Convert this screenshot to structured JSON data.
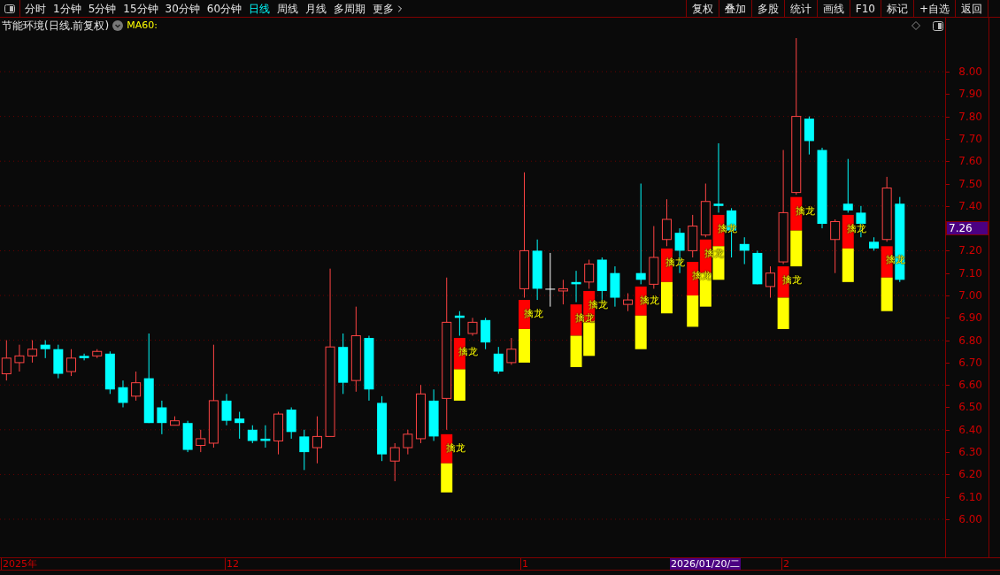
{
  "toolbar": {
    "periods": [
      {
        "label": "分时",
        "selected": false
      },
      {
        "label": "1分钟",
        "selected": false
      },
      {
        "label": "5分钟",
        "selected": false
      },
      {
        "label": "15分钟",
        "selected": false
      },
      {
        "label": "30分钟",
        "selected": false
      },
      {
        "label": "60分钟",
        "selected": false
      },
      {
        "label": "日线",
        "selected": true
      },
      {
        "label": "周线",
        "selected": false
      },
      {
        "label": "月线",
        "selected": false
      },
      {
        "label": "多周期",
        "selected": false
      },
      {
        "label": "更多",
        "selected": false
      }
    ],
    "actions": [
      "复权",
      "叠加",
      "多股",
      "统计",
      "画线",
      "F10",
      "标记",
      "+自选",
      "返回"
    ]
  },
  "chart": {
    "title": "节能环境(日线.前复权)",
    "indicator": "MA60:",
    "current_price": "7.26",
    "chart_data": {
      "type": "candlestick",
      "grid": true,
      "ylim": [
        5.83,
        8.17
      ],
      "yticks": [
        {
          "value": 8.0,
          "label": "8.00"
        },
        {
          "value": 7.9,
          "label": "7.90"
        },
        {
          "value": 7.8,
          "label": "7.80"
        },
        {
          "value": 7.7,
          "label": "7.70"
        },
        {
          "value": 7.6,
          "label": "7.60"
        },
        {
          "value": 7.5,
          "label": "7.50"
        },
        {
          "value": 7.4,
          "label": "7.40"
        },
        {
          "value": 7.2,
          "label": "7.20"
        },
        {
          "value": 7.1,
          "label": "7.10"
        },
        {
          "value": 7.0,
          "label": "7.00"
        },
        {
          "value": 6.9,
          "label": "6.90"
        },
        {
          "value": 6.8,
          "label": "6.80"
        },
        {
          "value": 6.7,
          "label": "6.70"
        },
        {
          "value": 6.6,
          "label": "6.60"
        },
        {
          "value": 6.5,
          "label": "6.50"
        },
        {
          "value": 6.4,
          "label": "6.40"
        },
        {
          "value": 6.3,
          "label": "6.30"
        },
        {
          "value": 6.2,
          "label": "6.20"
        },
        {
          "value": 6.1,
          "label": "6.10"
        },
        {
          "value": 6.0,
          "label": "6.00"
        }
      ],
      "ohlc": [
        [
          6.65,
          6.8,
          6.62,
          6.72
        ],
        [
          6.7,
          6.78,
          6.66,
          6.73
        ],
        [
          6.73,
          6.8,
          6.7,
          6.76
        ],
        [
          6.78,
          6.8,
          6.72,
          6.76
        ],
        [
          6.76,
          6.78,
          6.63,
          6.65
        ],
        [
          6.66,
          6.76,
          6.64,
          6.72
        ],
        [
          6.73,
          6.74,
          6.71,
          6.72
        ],
        [
          6.73,
          6.76,
          6.72,
          6.75
        ],
        [
          6.74,
          6.75,
          6.56,
          6.58
        ],
        [
          6.59,
          6.62,
          6.5,
          6.52
        ],
        [
          6.55,
          6.66,
          6.53,
          6.61
        ],
        [
          6.63,
          6.83,
          6.43,
          6.43
        ],
        [
          6.5,
          6.53,
          6.38,
          6.43
        ],
        [
          6.42,
          6.46,
          6.42,
          6.44
        ],
        [
          6.43,
          6.44,
          6.3,
          6.31
        ],
        [
          6.33,
          6.4,
          6.3,
          6.36
        ],
        [
          6.34,
          6.78,
          6.32,
          6.53
        ],
        [
          6.53,
          6.56,
          6.42,
          6.44
        ],
        [
          6.45,
          6.48,
          6.36,
          6.43
        ],
        [
          6.4,
          6.42,
          6.34,
          6.35
        ],
        [
          6.36,
          6.42,
          6.32,
          6.35
        ],
        [
          6.35,
          6.48,
          6.29,
          6.47
        ],
        [
          6.49,
          6.5,
          6.36,
          6.39
        ],
        [
          6.37,
          6.4,
          6.22,
          6.3
        ],
        [
          6.32,
          6.46,
          6.25,
          6.37
        ],
        [
          6.37,
          7.12,
          6.37,
          6.77
        ],
        [
          6.77,
          6.83,
          6.56,
          6.61
        ],
        [
          6.62,
          6.95,
          6.57,
          6.82
        ],
        [
          6.81,
          6.82,
          6.53,
          6.58
        ],
        [
          6.52,
          6.55,
          6.26,
          6.29
        ],
        [
          6.26,
          6.34,
          6.17,
          6.32
        ],
        [
          6.32,
          6.4,
          6.29,
          6.38
        ],
        [
          6.36,
          6.6,
          6.34,
          6.56
        ],
        [
          6.53,
          6.58,
          6.35,
          6.37
        ],
        [
          6.54,
          7.08,
          6.4,
          6.88
        ],
        [
          6.91,
          6.93,
          6.82,
          6.9
        ],
        [
          6.83,
          6.9,
          6.82,
          6.88
        ],
        [
          6.89,
          6.9,
          6.76,
          6.79
        ],
        [
          6.74,
          6.77,
          6.65,
          6.66
        ],
        [
          6.7,
          6.81,
          6.69,
          6.76
        ],
        [
          7.03,
          7.55,
          6.99,
          7.2
        ],
        [
          7.2,
          7.25,
          6.98,
          7.03
        ],
        [
          7.03,
          7.19,
          6.95,
          7.03
        ],
        [
          7.02,
          7.07,
          6.96,
          7.03
        ],
        [
          7.06,
          7.11,
          6.97,
          7.05
        ],
        [
          7.06,
          7.16,
          7.03,
          7.14
        ],
        [
          7.16,
          7.17,
          6.97,
          7.02
        ],
        [
          7.1,
          7.13,
          6.95,
          6.99
        ],
        [
          6.96,
          7.01,
          6.93,
          6.98
        ],
        [
          7.1,
          7.5,
          7.05,
          7.07
        ],
        [
          7.05,
          7.31,
          7.03,
          7.17
        ],
        [
          7.25,
          7.43,
          7.22,
          7.34
        ],
        [
          7.28,
          7.3,
          7.1,
          7.2
        ],
        [
          7.2,
          7.36,
          7.17,
          7.31
        ],
        [
          7.27,
          7.5,
          7.26,
          7.42
        ],
        [
          7.41,
          7.68,
          7.37,
          7.4
        ],
        [
          7.38,
          7.39,
          7.17,
          7.29
        ],
        [
          7.23,
          7.26,
          7.14,
          7.2
        ],
        [
          7.19,
          7.2,
          7.05,
          7.05
        ],
        [
          7.04,
          7.13,
          6.99,
          7.1
        ],
        [
          7.15,
          7.65,
          7.14,
          7.37
        ],
        [
          7.46,
          8.15,
          7.45,
          7.8
        ],
        [
          7.79,
          7.8,
          7.63,
          7.69
        ],
        [
          7.65,
          7.66,
          7.3,
          7.32
        ],
        [
          7.25,
          7.34,
          7.1,
          7.33
        ],
        [
          7.41,
          7.61,
          7.37,
          7.38
        ],
        [
          7.37,
          7.4,
          7.26,
          7.32
        ],
        [
          7.24,
          7.26,
          7.2,
          7.21
        ],
        [
          7.25,
          7.53,
          7.24,
          7.48
        ],
        [
          7.41,
          7.44,
          7.06,
          7.07
        ],
        null,
        null,
        null
      ]
    },
    "signals": [
      {
        "label": "擒龙"
      },
      {
        "label": "擒龙"
      },
      {
        "label": "擒龙"
      },
      {
        "label": "擒龙"
      },
      {
        "label": "擒龙"
      },
      {
        "label": "擒龙"
      },
      {
        "label": "擒龙"
      },
      {
        "label": "擒龙"
      },
      {
        "label": "擒龙"
      },
      {
        "label": "擒龙"
      },
      {
        "label": "擒龙"
      },
      {
        "label": "擒龙"
      },
      {
        "label": "擒龙"
      },
      {
        "label": "擒龙"
      }
    ],
    "date_axis": [
      {
        "label": "2025年",
        "kind": "tick"
      },
      {
        "label": "12",
        "kind": "tick"
      },
      {
        "label": "1",
        "kind": "tick"
      },
      {
        "label": "2026/01/20/二",
        "kind": "cursor"
      },
      {
        "label": "2",
        "kind": "tick"
      }
    ]
  }
}
